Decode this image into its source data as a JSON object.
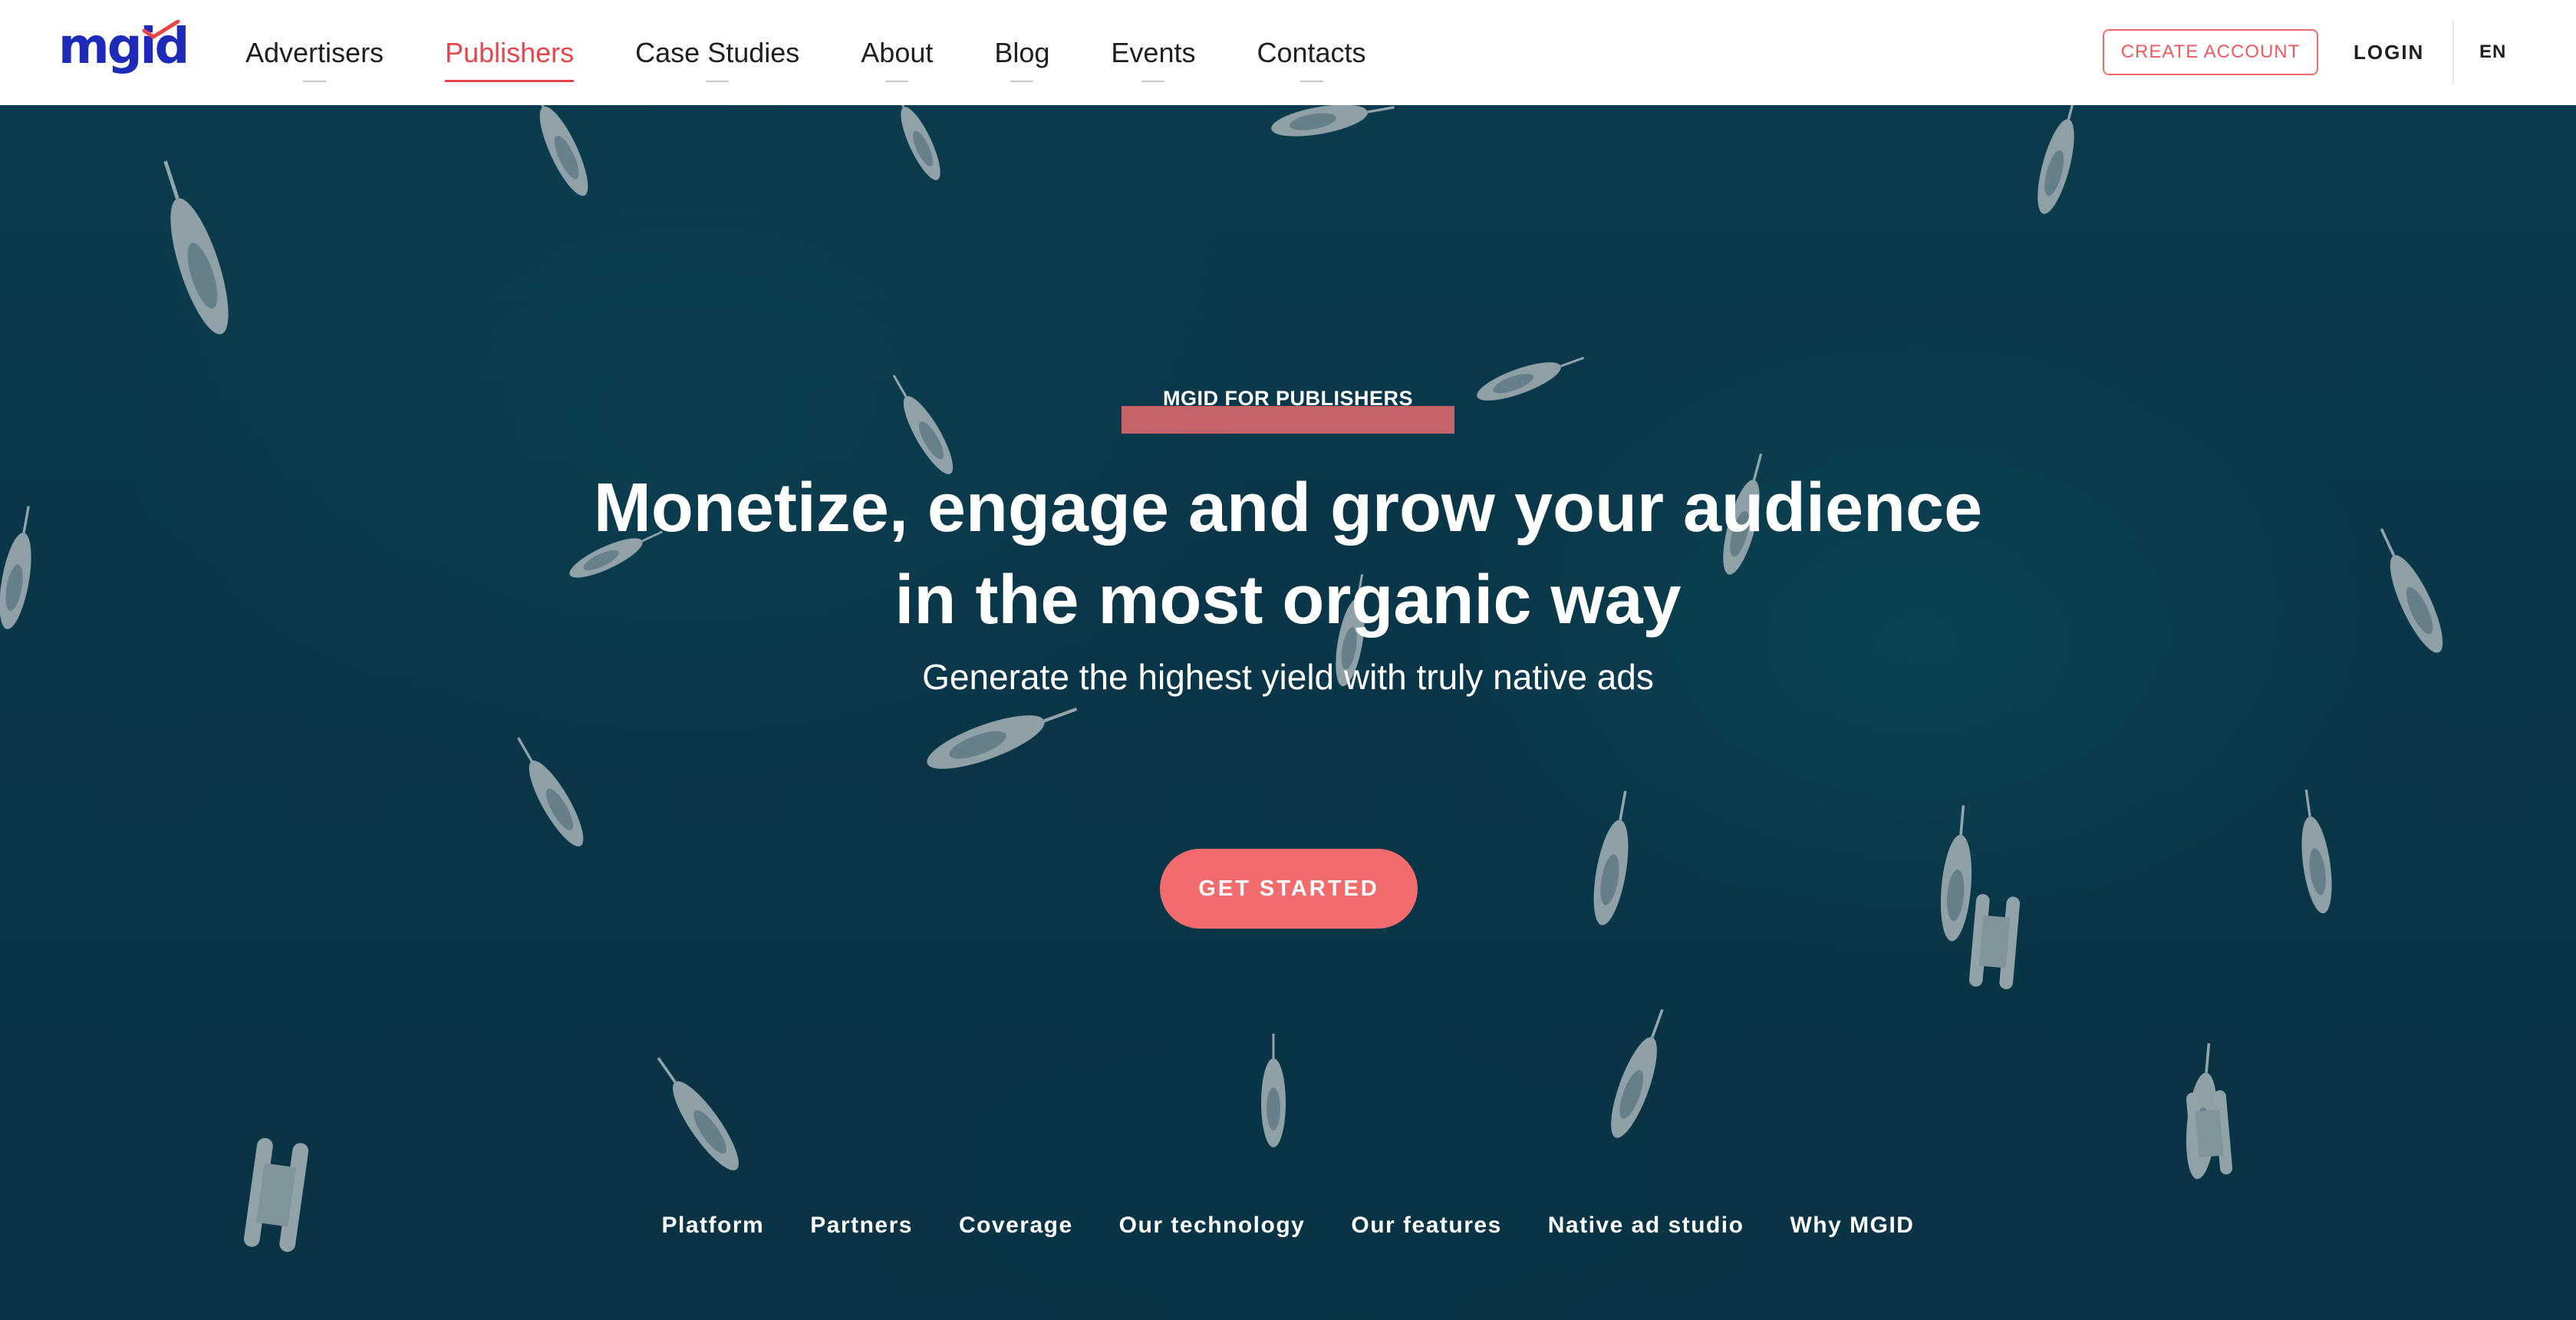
{
  "brand": {
    "logo_text": "mgid",
    "logo_color": "#1d2bb8",
    "accent_color": "#e8444a"
  },
  "header": {
    "nav": [
      {
        "label": "Advertisers",
        "active": false
      },
      {
        "label": "Publishers",
        "active": true
      },
      {
        "label": "Case Studies",
        "active": false
      },
      {
        "label": "About",
        "active": false
      },
      {
        "label": "Blog",
        "active": false
      },
      {
        "label": "Events",
        "active": false
      },
      {
        "label": "Contacts",
        "active": false
      }
    ],
    "create_account_label": "CREATE ACCOUNT",
    "login_label": "LOGIN",
    "language": "EN"
  },
  "hero": {
    "kicker": "MGID FOR PUBLISHERS",
    "headline_line1": "Monetize, engage and grow your audience",
    "headline_line2": "in the most organic way",
    "subheadline": "Generate the highest yield with truly native ads",
    "cta_label": "GET STARTED",
    "cta_color": "#f26b6d",
    "background": "aerial photo of sailboats on dark teal sea"
  },
  "section_nav": [
    {
      "label": "Platform"
    },
    {
      "label": "Partners"
    },
    {
      "label": "Coverage"
    },
    {
      "label": "Our technology"
    },
    {
      "label": "Our features"
    },
    {
      "label": "Native ad studio"
    },
    {
      "label": "Why MGID"
    }
  ]
}
